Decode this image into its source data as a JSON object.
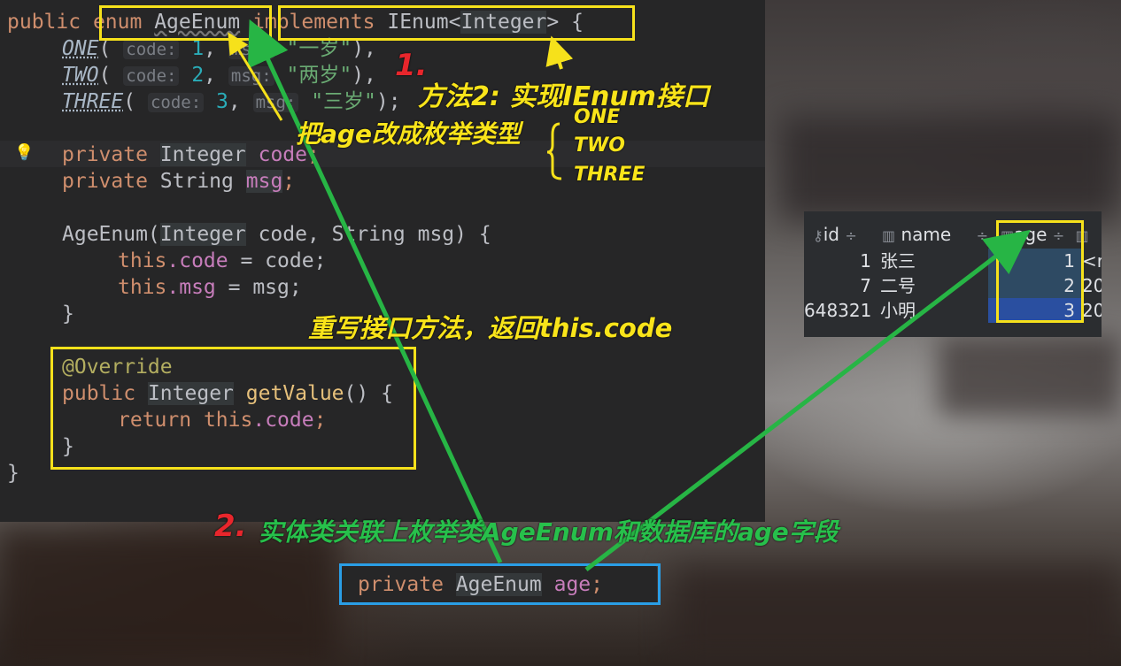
{
  "code": {
    "enum_decl": {
      "public": "public",
      "enum": "enum",
      "name": "AgeEnum",
      "implements": "implements",
      "iface": "IEnum<",
      "type": "Integer",
      "close": ">",
      "brace": " {"
    },
    "constants": [
      {
        "name": "ONE",
        "code_hint": "code:",
        "code": "1",
        "msg_hint": "msg:",
        "msg": "\"一岁\"",
        "end": "),"
      },
      {
        "name": "TWO",
        "code_hint": "code:",
        "code": "2",
        "msg_hint": "msg:",
        "msg": "\"两岁\"",
        "end": "),"
      },
      {
        "name": "THREE",
        "code_hint": "code:",
        "code": "3",
        "msg_hint": "msg:",
        "msg": "\"三岁\"",
        "end": ");"
      }
    ],
    "field_code": {
      "kw": "private",
      "type": "Integer",
      "name": "code",
      "end": ";"
    },
    "field_msg": {
      "kw": "private",
      "type": "String",
      "name": "msg",
      "end": ";"
    },
    "ctor": {
      "name": "AgeEnum(",
      "t1": "Integer",
      "p1": " code, ",
      "t2": "String",
      "p2": " msg) {"
    },
    "ctor_body1": {
      "this": "this",
      "rest": ".code",
      "eq": " = code;"
    },
    "ctor_body2": {
      "this": "this",
      "rest": ".msg",
      "eq": " = msg;"
    },
    "ctor_close": "}",
    "override": "@Override",
    "getvalue": {
      "kw": "public",
      "type": "Integer",
      "name": "getValue",
      "rest": "() {"
    },
    "ret": {
      "kw": "return",
      "this": "this",
      "rest": ".code",
      "end": ";"
    },
    "m_close": "}",
    "enum_close": "}"
  },
  "entity": {
    "kw": "private",
    "type": "AgeEnum",
    "name": "age",
    "end": ";"
  },
  "annotations": {
    "step1_num": "1.",
    "step1_title": "方法2: 实现IEnum接口",
    "change_age": "把age改成枚举类型",
    "enum_values": [
      "ONE",
      "TWO",
      "THREE"
    ],
    "override_note": "重写接口方法，返回this.code",
    "step2_num": "2.",
    "step2_text": "实体类关联上枚举类AgeEnum和数据库的age字段"
  },
  "db_table": {
    "columns": [
      "id",
      "name",
      "age"
    ],
    "rows": [
      {
        "id": "1",
        "name": "张三",
        "age": "1",
        "extra": "<r"
      },
      {
        "id": "7",
        "name": "二号",
        "age": "2",
        "extra": "20"
      },
      {
        "id": "648321",
        "name": "小明",
        "age": "3",
        "extra": "20"
      }
    ]
  },
  "colors": {
    "highlight_box": "#f6e11b",
    "entity_box": "#2a9ee6",
    "arrow": "#27b545",
    "step_num": "#e8262c"
  }
}
